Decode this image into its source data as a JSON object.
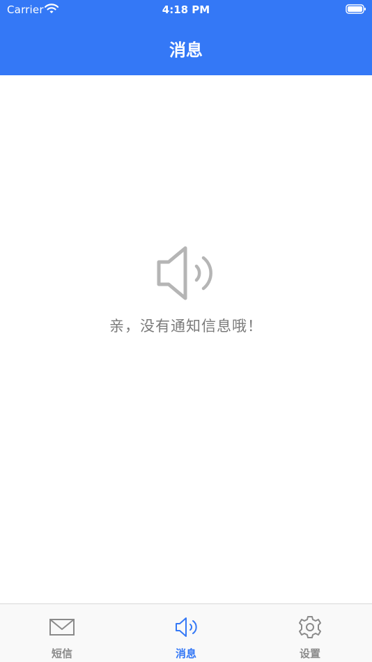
{
  "status_bar": {
    "carrier": "Carrier",
    "time": "4:18 PM"
  },
  "header": {
    "title": "消息",
    "background": "#3478f6"
  },
  "empty_state": {
    "icon": "speaker-icon",
    "message": "亲，没有通知信息哦！"
  },
  "tabbar": {
    "active_color": "#3478f6",
    "inactive_color": "#8a8a8a",
    "tabs": [
      {
        "label": "短信",
        "icon": "envelope-icon",
        "active": false
      },
      {
        "label": "消息",
        "icon": "speaker-icon",
        "active": true
      },
      {
        "label": "设置",
        "icon": "gear-icon",
        "active": false
      }
    ]
  }
}
